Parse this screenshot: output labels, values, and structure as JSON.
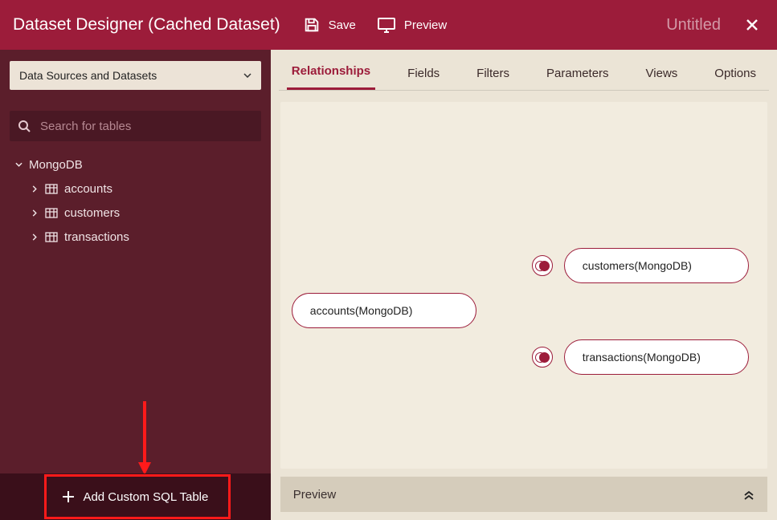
{
  "header": {
    "title": "Dataset Designer (Cached Dataset)",
    "save_label": "Save",
    "preview_label": "Preview",
    "document_name": "Untitled"
  },
  "sidebar": {
    "dropdown_label": "Data Sources and Datasets",
    "search_placeholder": "Search for tables",
    "source_name": "MongoDB",
    "tables": [
      {
        "label": "accounts"
      },
      {
        "label": "customers"
      },
      {
        "label": "transactions"
      }
    ],
    "add_button_label": "Add Custom SQL Table"
  },
  "tabs": [
    {
      "label": "Relationships",
      "active": true
    },
    {
      "label": "Fields",
      "active": false
    },
    {
      "label": "Filters",
      "active": false
    },
    {
      "label": "Parameters",
      "active": false
    },
    {
      "label": "Views",
      "active": false
    },
    {
      "label": "Options",
      "active": false
    }
  ],
  "canvas": {
    "nodes": {
      "root": "accounts(MongoDB)",
      "child1": "customers(MongoDB)",
      "child2": "transactions(MongoDB)"
    }
  },
  "preview_label": "Preview"
}
